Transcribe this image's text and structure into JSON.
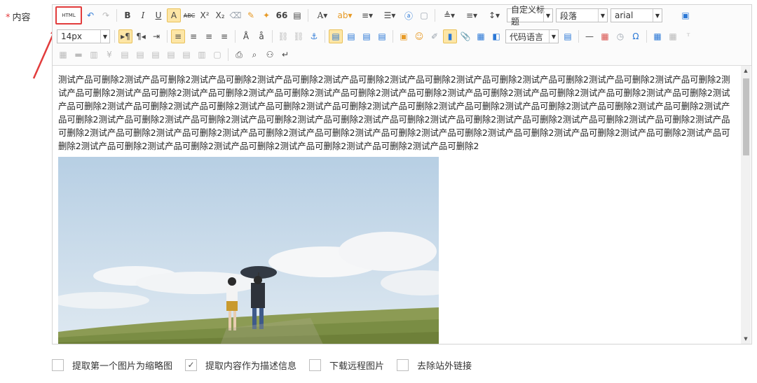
{
  "field": {
    "required_mark": "*",
    "label": "内容"
  },
  "toolbar": {
    "html_label": "HTML",
    "font_size": "14px",
    "heading": "自定义标题",
    "paragraph": "段落",
    "font_family": "arial",
    "code_language": "代码语言",
    "quote_glyph": "66",
    "abc": "ABC"
  },
  "content": {
    "text": "测试产品可删除2测试产品可删除2测试产品可删除2测试产品可删除2测试产品可删除2测试产品可删除2测试产品可删除2测试产品可删除2测试产品可删除2测试产品可删除2测试产品可删除2测试产品可删除2测试产品可删除2测试产品可删除2测试产品可删除2测试产品可删除2测试产品可删除2测试产品可删除2测试产品可删除2测试产品可删除2测试产品可删除2测试产品可删除2测试产品可删除2测试产品可删除2测试产品可删除2测试产品可删除2测试产品可删除2测试产品可删除2测试产品可删除2测试产品可删除2测试产品可删除2测试产品可删除2测试产品可删除2测试产品可删除2测试产品可删除2测试产品可删除2测试产品可删除2测试产品可删除2测试产品可删除2测试产品可删除2测试产品可删除2测试产品可删除2测试产品可删除2测试产品可删除2测试产品可删除2测试产品可删除2测试产品可删除2测试产品可删除2测试产品可删除2测试产品可删除2测试产品可删除2测试产品可删除2测试产品可删除2测试产品可删除2测试产品可删除2测试产品可删除2测试产品可删除2"
  },
  "options": [
    {
      "label": "提取第一个图片为缩略图",
      "checked": false
    },
    {
      "label": "提取内容作为描述信息",
      "checked": true
    },
    {
      "label": "下载远程图片",
      "checked": false
    },
    {
      "label": "去除站外链接",
      "checked": false
    }
  ],
  "icons": {
    "checkmark": "✓"
  },
  "colors": {
    "highlight_border": "#e23c3c",
    "active_button": "#fde6a6",
    "required": "#e4393c"
  }
}
